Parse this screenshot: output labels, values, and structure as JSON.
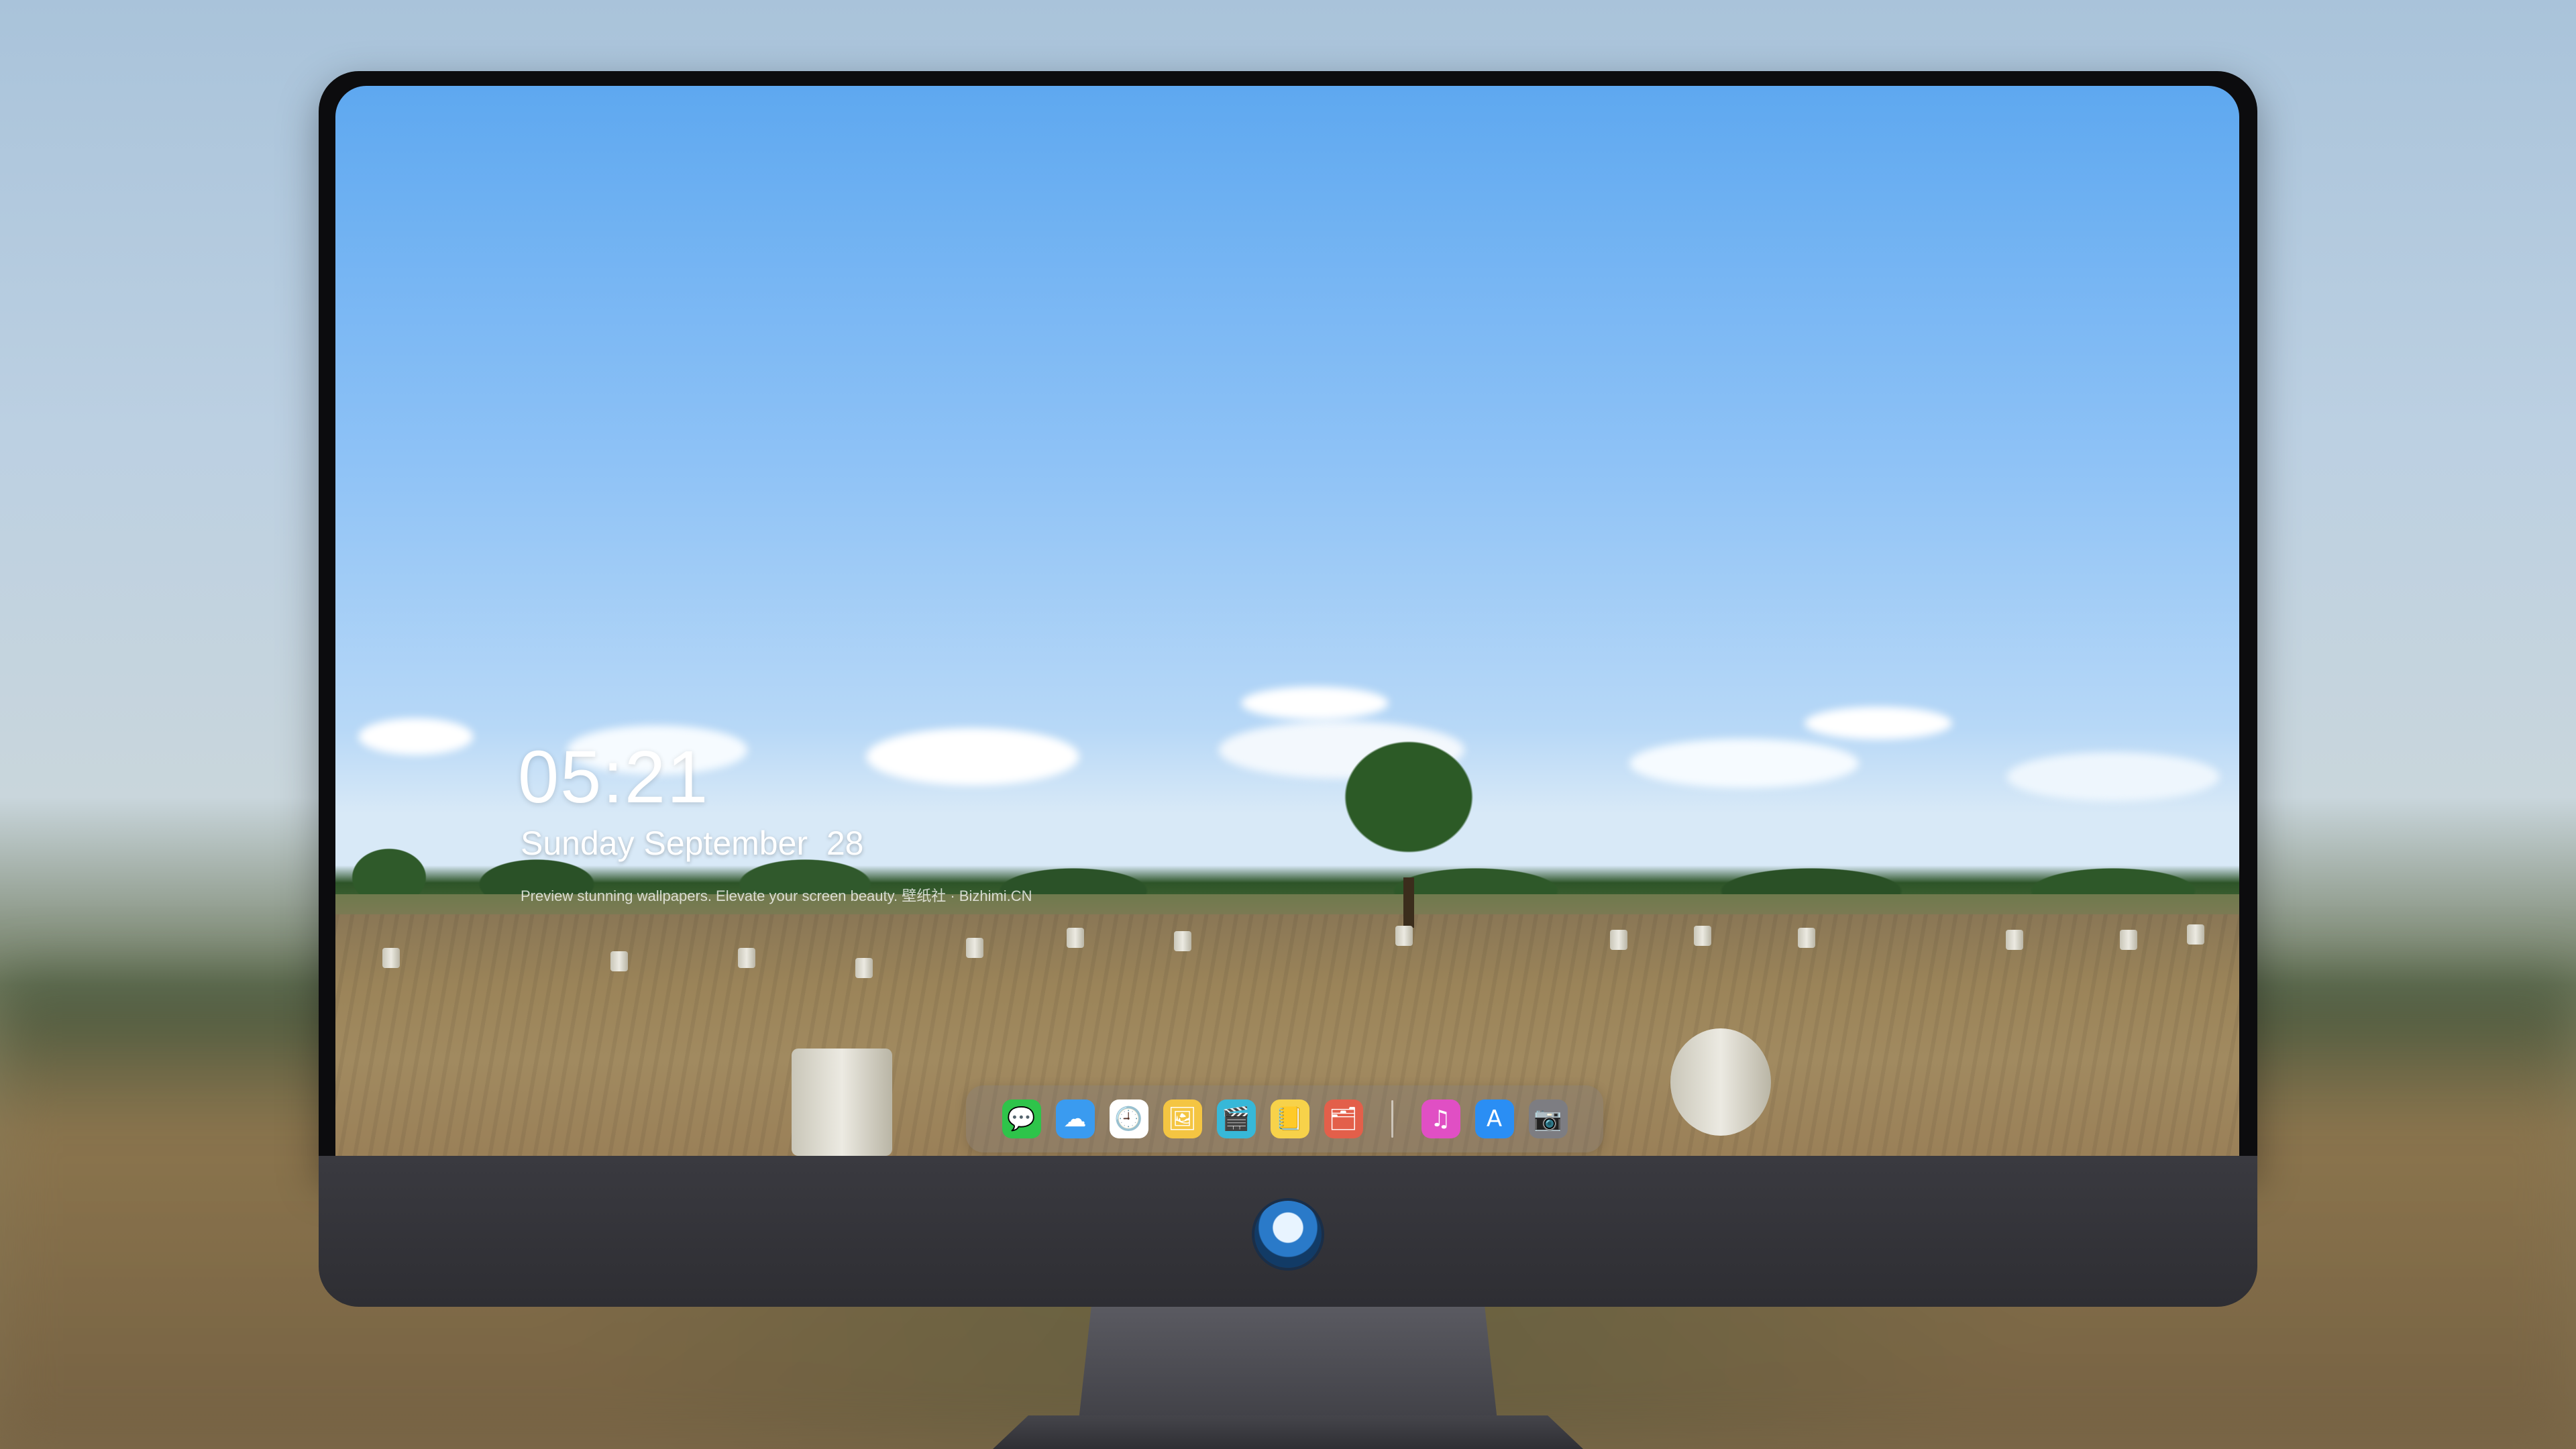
{
  "lockscreen": {
    "time": "05:21",
    "date": "Sunday September  28",
    "subtitle": "Preview stunning wallpapers. Elevate your screen beauty. 壁纸社 · Bizhimi.CN"
  },
  "dock": {
    "items": [
      {
        "name": "messages-icon",
        "glyph": "💬",
        "color": "#2ec44a"
      },
      {
        "name": "weather-icon",
        "glyph": "☁",
        "color": "#3a9bf0"
      },
      {
        "name": "clock-icon",
        "glyph": "🕘",
        "color": "#ffffff"
      },
      {
        "name": "preview-icon",
        "glyph": "🖼",
        "color": "#f4c542"
      },
      {
        "name": "video-editor-icon",
        "glyph": "🎬",
        "color": "#37b8d8"
      },
      {
        "name": "notes-icon",
        "glyph": "📒",
        "color": "#f7d24a"
      },
      {
        "name": "photos-app-icon",
        "glyph": "🗂",
        "color": "#e35f4a"
      },
      {
        "name": "music-icon",
        "glyph": "♫",
        "color": "#e04fc4"
      },
      {
        "name": "app-store-icon",
        "glyph": "A",
        "color": "#2a8ef4"
      },
      {
        "name": "camera-icon",
        "glyph": "📷",
        "color": "#7d7d82"
      }
    ]
  },
  "monitor": {
    "logo_icon": "dragon-mascot-icon"
  }
}
